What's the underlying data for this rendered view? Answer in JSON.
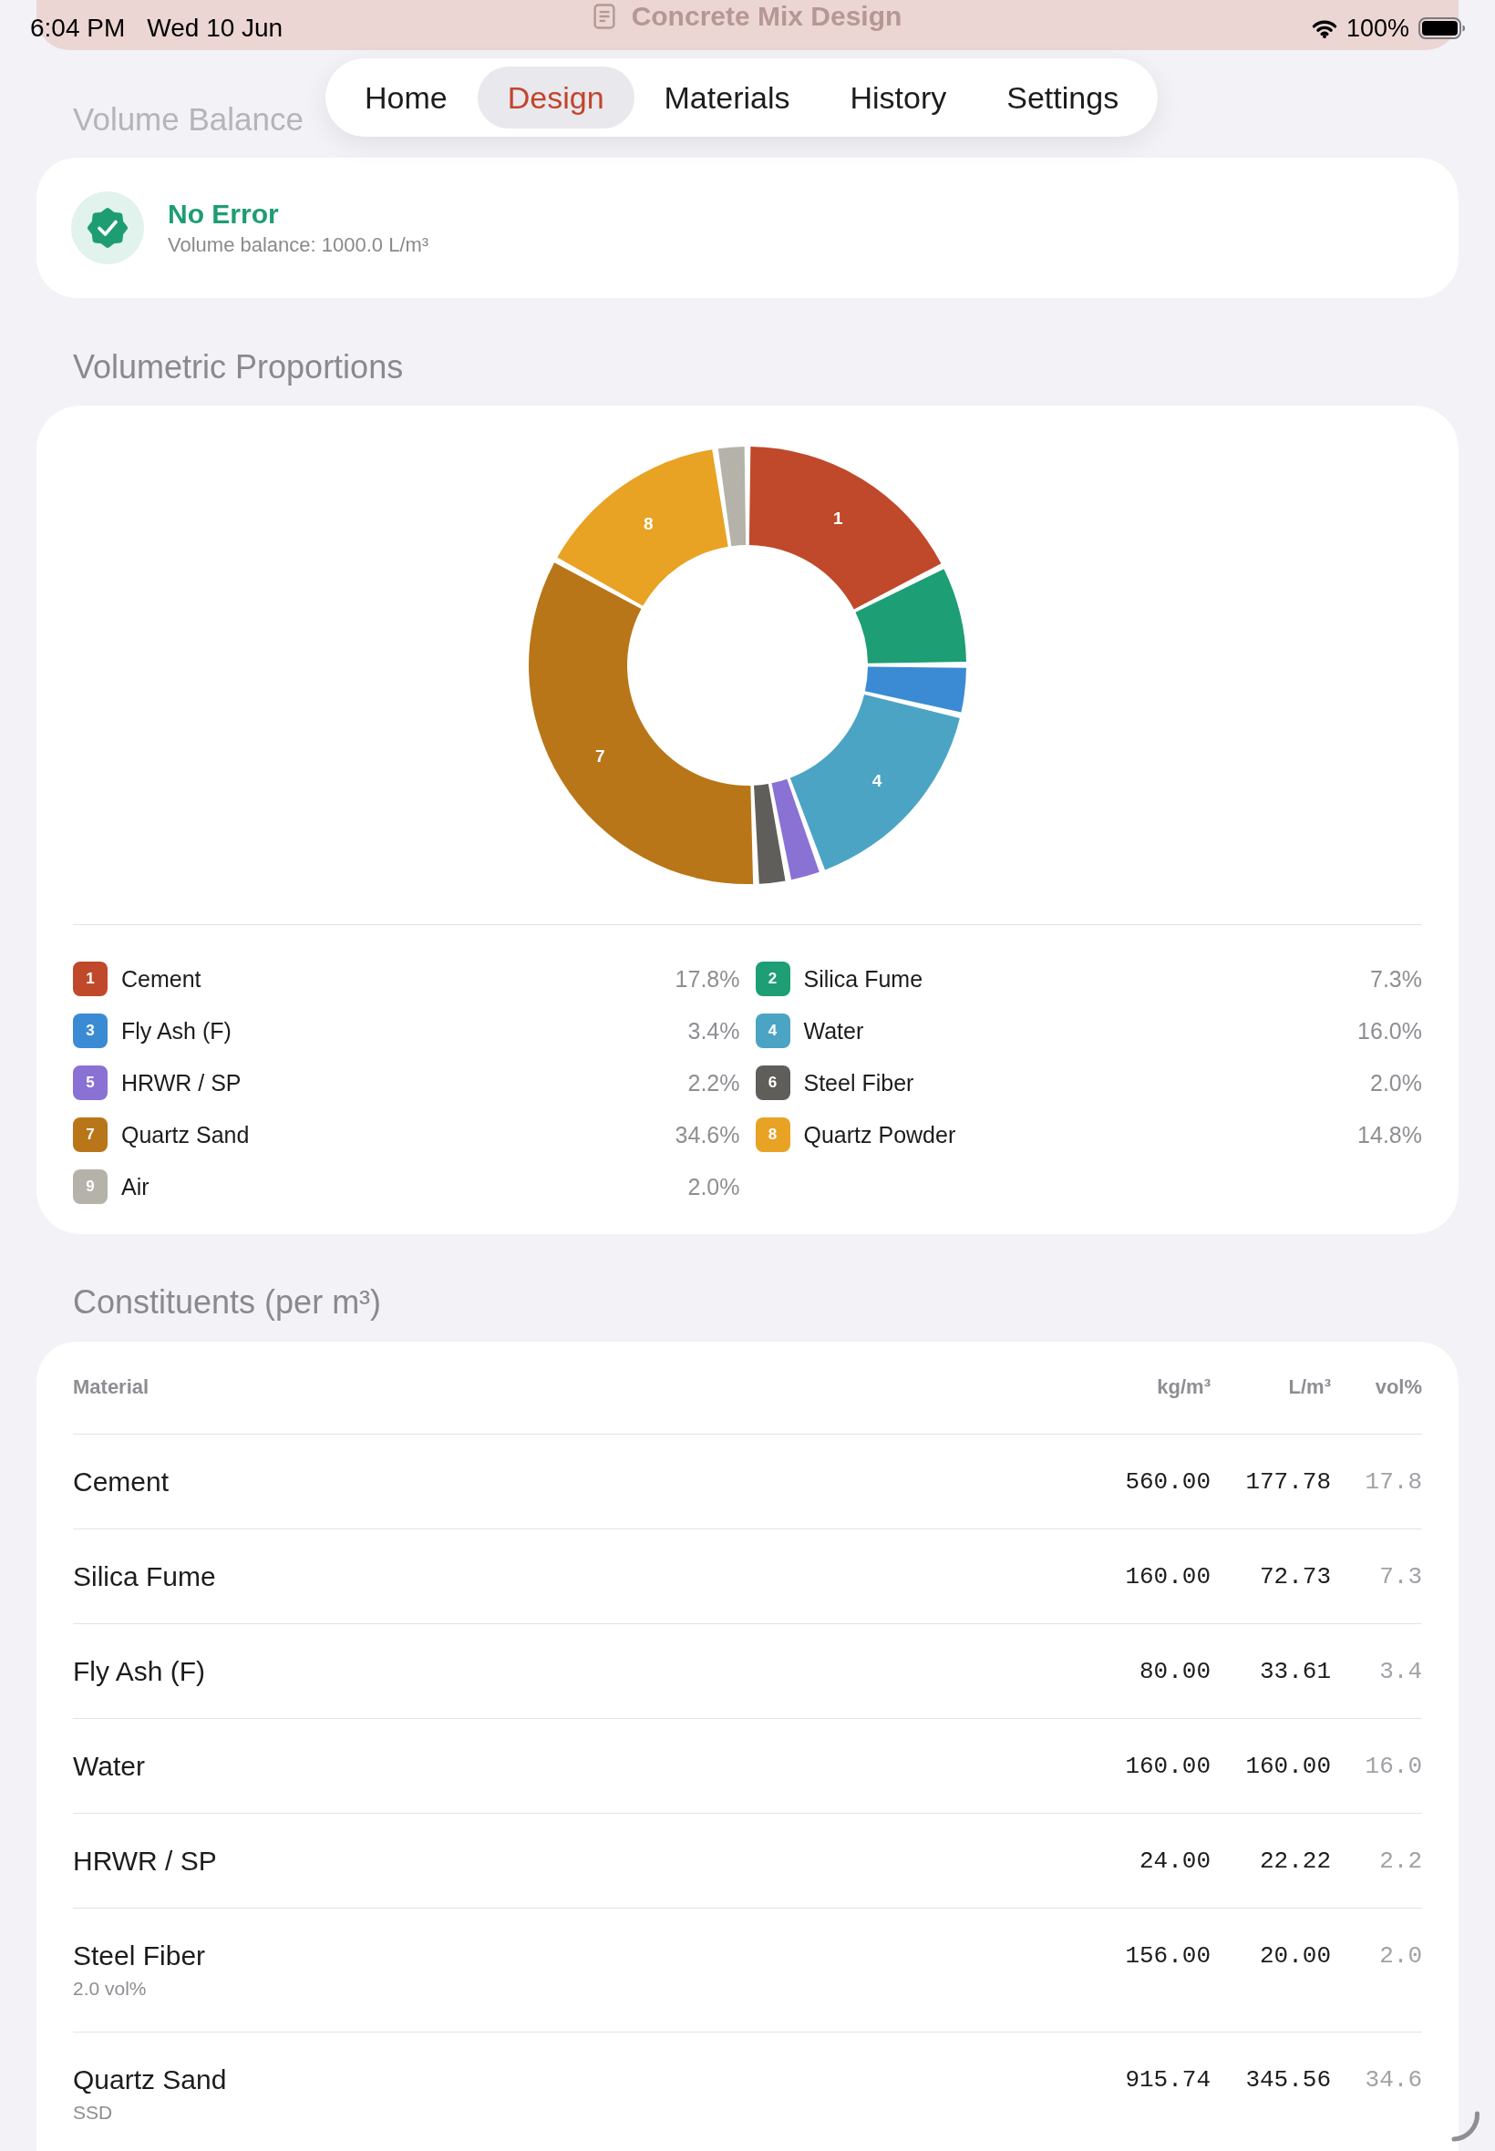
{
  "status_bar": {
    "time": "6:04 PM",
    "date": "Wed 10 Jun",
    "battery": "100%"
  },
  "nav_bar": {
    "title": "Concrete Mix Design"
  },
  "tabs": [
    {
      "label": "Home",
      "selected": false
    },
    {
      "label": "Design",
      "selected": true
    },
    {
      "label": "Materials",
      "selected": false
    },
    {
      "label": "History",
      "selected": false
    },
    {
      "label": "Settings",
      "selected": false
    }
  ],
  "volume_balance": {
    "title": "Volume Balance",
    "kind": "ok",
    "status": "No Error",
    "detail": "Volume balance: 1000.0 L/m³"
  },
  "proportions": {
    "title": "Volumetric Proportions",
    "chart_data": {
      "type": "donut",
      "categories": [
        "Cement",
        "Silica Fume",
        "Fly Ash (F)",
        "Water",
        "HRWR / SP",
        "Steel Fiber",
        "Quartz Sand",
        "Quartz Powder",
        "Air"
      ],
      "values": [
        17.8,
        7.3,
        3.4,
        16.0,
        2.2,
        2.0,
        34.6,
        14.8,
        2.0
      ],
      "annotations": [
        "1",
        null,
        null,
        "4",
        null,
        null,
        "7",
        "8",
        null
      ]
    },
    "legend": [
      {
        "number": "1",
        "percent": "17.8%",
        "color": "#c0492b"
      },
      {
        "number": "2",
        "percent": "7.3%",
        "color": "#1e9e74"
      },
      {
        "number": "3",
        "percent": "3.4%",
        "color": "#3b8bd4"
      },
      {
        "number": "4",
        "percent": "16.0%",
        "color": "#4ba4c4"
      },
      {
        "number": "5",
        "percent": "2.2%",
        "color": "#8a71d4"
      },
      {
        "number": "6",
        "percent": "2.0%",
        "color": "#5f5e5a"
      },
      {
        "number": "7",
        "percent": "34.6%",
        "color": "#b87619"
      },
      {
        "number": "8",
        "percent": "14.8%",
        "color": "#e8a224"
      },
      {
        "number": "9",
        "percent": "2.0%",
        "color": "#b5b2aa"
      }
    ]
  },
  "constituents": {
    "title": "Constituents (per m³)",
    "columns": [
      "Material",
      "kg/m³",
      "L/m³",
      "vol%"
    ],
    "rows": [
      {
        "name": "Cement",
        "kg": "560.00",
        "liters": "177.78",
        "vol": "17.8"
      },
      {
        "name": "Silica Fume",
        "kg": "160.00",
        "liters": "72.73",
        "vol": "7.3"
      },
      {
        "name": "Fly Ash (F)",
        "kg": "80.00",
        "liters": "33.61",
        "vol": "3.4"
      },
      {
        "name": "Water",
        "kg": "160.00",
        "liters": "160.00",
        "vol": "16.0"
      },
      {
        "name": "HRWR / SP",
        "kg": "24.00",
        "liters": "22.22",
        "vol": "2.2"
      },
      {
        "name": "Steel Fiber",
        "note": "2.0 vol%",
        "kg": "156.00",
        "liters": "20.00",
        "vol": "2.0"
      },
      {
        "name": "Quartz Sand",
        "note": "SSD",
        "kg": "915.74",
        "liters": "345.56",
        "vol": "34.6"
      }
    ]
  }
}
